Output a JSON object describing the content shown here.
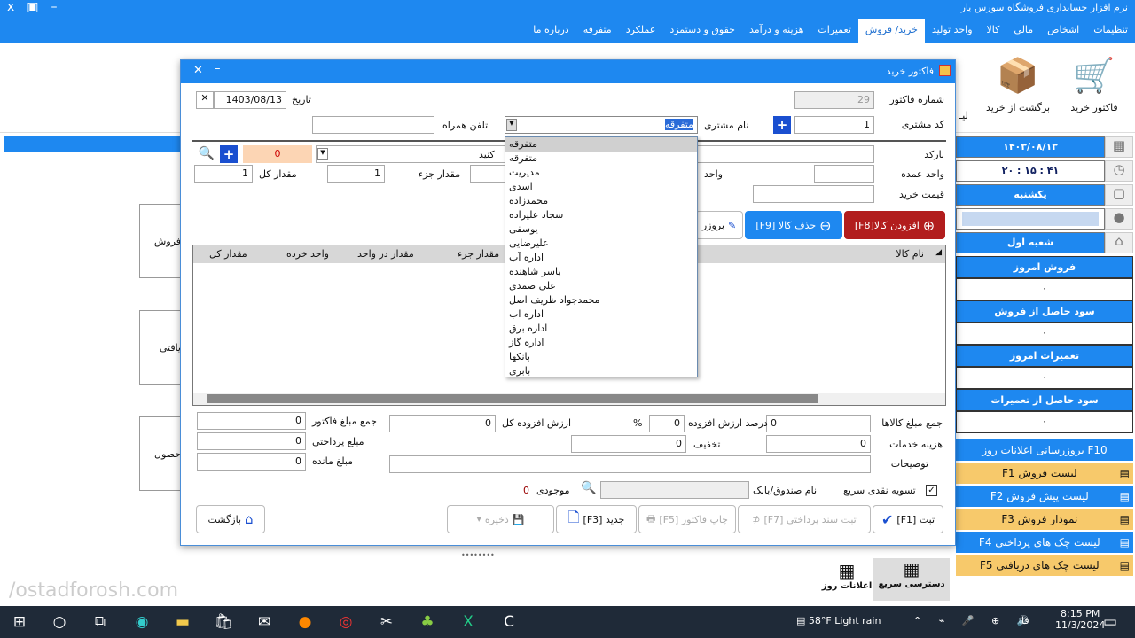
{
  "app": {
    "title": "نرم افزار حسابداری فروشگاه سورس یار",
    "window_controls": [
      "x",
      "▣",
      "–"
    ]
  },
  "menu": [
    "تنظیمات",
    "اشخاص",
    "مالی",
    "کالا",
    "واحد تولید",
    "خرید/ فروش",
    "تعمیرات",
    "هزینه و درآمد",
    "حقوق و دستمزد",
    "عملکرد",
    "متفرقه",
    "درباره ما"
  ],
  "menu_active": "خرید/ فروش",
  "ribbon": {
    "purchase_invoice": "فاکتور خرید",
    "purchase_return": "برگشت از خرید",
    "partial": "لیـ"
  },
  "sidebar": {
    "date": "۱۴۰۳/۰۸/۱۳",
    "time": "۲۰ : ۱۵ : ۴۱",
    "weekday": "یکشنبه",
    "branch": "شعبه اول",
    "stats": [
      {
        "label": "فروش امروز",
        "value": "۰"
      },
      {
        "label": "سود حاصل از فروش",
        "value": "۰"
      },
      {
        "label": "تعمیرات امروز",
        "value": "۰"
      },
      {
        "label": "سود حاصل از تعمیرات",
        "value": "۰"
      }
    ],
    "refresh": "بروزرسانی اعلانات روز F10",
    "quick": [
      {
        "label": "لیست فروش F1",
        "style": "o"
      },
      {
        "label": "لیست پیش فروش F2",
        "style": "b"
      },
      {
        "label": "نمودار فروش F3",
        "style": "o"
      },
      {
        "label": "لیست چک های پرداختی F4",
        "style": "b"
      },
      {
        "label": "لیست چک های دریافتی F5",
        "style": "o"
      }
    ]
  },
  "bottom_tiles": {
    "quick_access": "دسترسی سریع",
    "daily_notices": "اعلانات روز"
  },
  "bg_tiles": [
    "فروش",
    "یافتی",
    "حصول"
  ],
  "watermark": "/ostadforosh.com",
  "dialog": {
    "title": "فاکتور خرید",
    "invoice_no_label": "شماره فاکتور",
    "invoice_no": "29",
    "date_label": "تاریخ",
    "date": "1403/08/13",
    "customer_code_label": "کد مشتری",
    "customer_code": "1",
    "customer_name_label": "نام مشتری",
    "customer_name": "متفرقه",
    "mobile_label": "تلفن همراه",
    "mobile": "",
    "barcode_label": "بارکد",
    "wholesale_unit_label": "واحد عمده",
    "unit_label": "واحد",
    "purchase_price_label": "قیمت خرید",
    "product_placeholder": "کنید",
    "stock_value": "0",
    "partial_qty_label": "مقدار جزء",
    "partial_qty": "1",
    "total_qty_label": "مقدار کل",
    "total_qty": "1",
    "add_btn": "افزودن کالا[F8]",
    "delete_btn": "حذف کالا [F9]",
    "update_btn": "بروزر",
    "columns": [
      "نام کالا",
      "مقدار جزء",
      "مقدار در واحد",
      "واحد خرده",
      "مقدار کل"
    ],
    "customers": [
      "متفرقه",
      "متفرقه",
      "مدیریت",
      "اسدی",
      "محمدزاده",
      "سجاد علیزاده",
      "یوسفی",
      "علیرضایی",
      "اداره آب",
      "یاسر شاهنده",
      "علی صمدی",
      "محمدجواد ظریف اصل",
      "اداره اب",
      "اداره برق",
      "اداره گاز",
      "بانکها",
      "بابری"
    ],
    "totals": {
      "goods_total_label": "جمع مبلغ کالاها",
      "goods_total": "0",
      "vat_pct_label": "درصد ارزش افزوده",
      "vat_pct": "0",
      "pct": "%",
      "vat_total_label": "ارزش افزوده کل",
      "vat_total": "0",
      "invoice_total_label": "جمع مبلغ فاکتور",
      "invoice_total": "0",
      "services_label": "هزینه خدمات",
      "services": "0",
      "discount_label": "تخفیف",
      "discount": "0",
      "paid_label": "مبلغ پرداختی",
      "paid": "0",
      "notes_label": "توضیحات",
      "remaining_label": "مبلغ مانده",
      "remaining": "0"
    },
    "quick_cash_label": "تسویه نقدی سریع",
    "cashbox_label": "نام صندوق/بانک",
    "balance_label": "موجودی",
    "balance": "0",
    "buttons": {
      "submit": "ثبت [F1]",
      "payment_doc": "ثبت سند پرداختی [F7]",
      "print": "چاپ فاکتور [F5]",
      "new": "جدید [F3]",
      "save": "ذخیره",
      "back": "بازگشت"
    }
  },
  "taskbar": {
    "weather": "58°F  Light rain",
    "lang": "فا",
    "time": "8:15 PM",
    "date": "11/3/2024"
  }
}
